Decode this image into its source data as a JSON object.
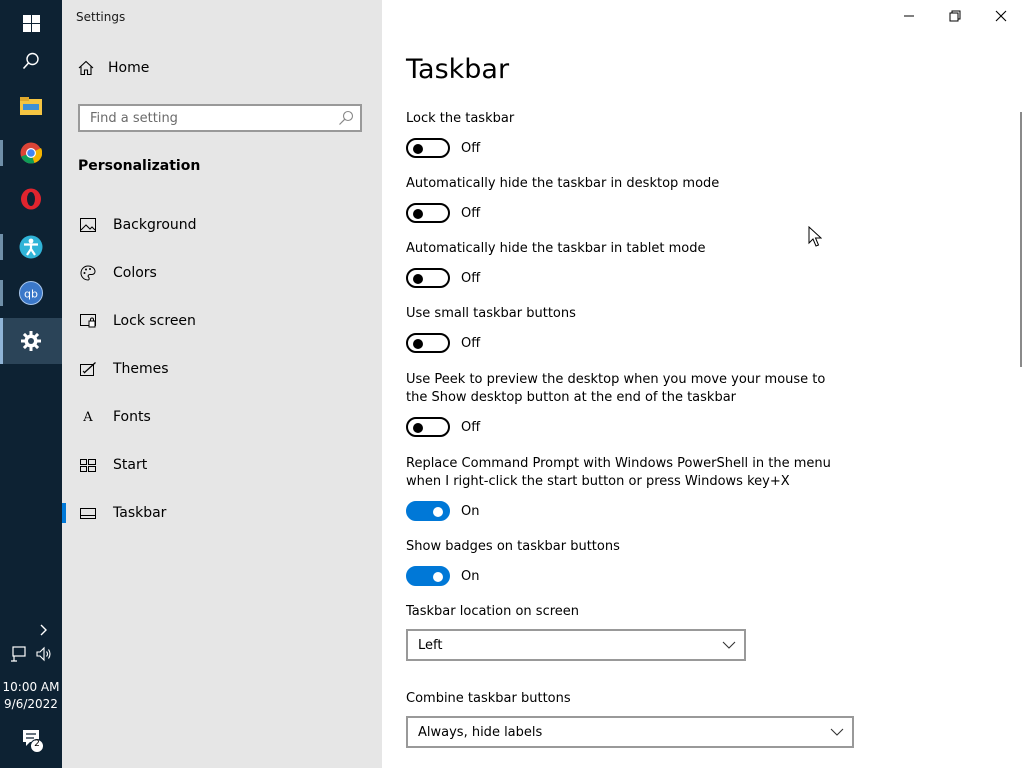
{
  "taskbar": {
    "apps": [
      {
        "name": "Start"
      },
      {
        "name": "Search"
      },
      {
        "name": "File Explorer"
      },
      {
        "name": "Google Chrome"
      },
      {
        "name": "Opera"
      },
      {
        "name": "Accessibility app"
      },
      {
        "name": "qBittorrent"
      },
      {
        "name": "Settings"
      }
    ],
    "qb_text": "qb",
    "time": "10:00 AM",
    "date": "9/6/2022",
    "notification_count": "2"
  },
  "window": {
    "title": "Settings"
  },
  "sidebar": {
    "home_label": "Home",
    "search_placeholder": "Find a setting",
    "section": "Personalization",
    "items": [
      {
        "label": "Background",
        "icon": "picture-icon"
      },
      {
        "label": "Colors",
        "icon": "palette-icon"
      },
      {
        "label": "Lock screen",
        "icon": "lock-screen-icon"
      },
      {
        "label": "Themes",
        "icon": "themes-icon"
      },
      {
        "label": "Fonts",
        "icon": "fonts-icon"
      },
      {
        "label": "Start",
        "icon": "start-icon"
      },
      {
        "label": "Taskbar",
        "icon": "taskbar-icon",
        "selected": true
      }
    ],
    "fonts_icon_text": "A"
  },
  "main": {
    "title": "Taskbar",
    "settings": [
      {
        "label": "Lock the taskbar",
        "state": "Off"
      },
      {
        "label": "Automatically hide the taskbar in desktop mode",
        "state": "Off"
      },
      {
        "label": "Automatically hide the taskbar in tablet mode",
        "state": "Off"
      },
      {
        "label": "Use small taskbar buttons",
        "state": "Off"
      },
      {
        "label": "Use Peek to preview the desktop when you move your mouse to the Show desktop button at the end of the taskbar",
        "state": "Off"
      },
      {
        "label": "Replace Command Prompt with Windows PowerShell in the menu when I right-click the start button or press Windows key+X",
        "state": "On"
      },
      {
        "label": "Show badges on taskbar buttons",
        "state": "On"
      }
    ],
    "location_label": "Taskbar location on screen",
    "location_value": "Left",
    "combine_label": "Combine taskbar buttons",
    "combine_value": "Always, hide labels"
  },
  "colors": {
    "accent": "#0078d7",
    "taskbar_bg": "#0d2233",
    "sidebar_bg": "#e6e6e6"
  }
}
